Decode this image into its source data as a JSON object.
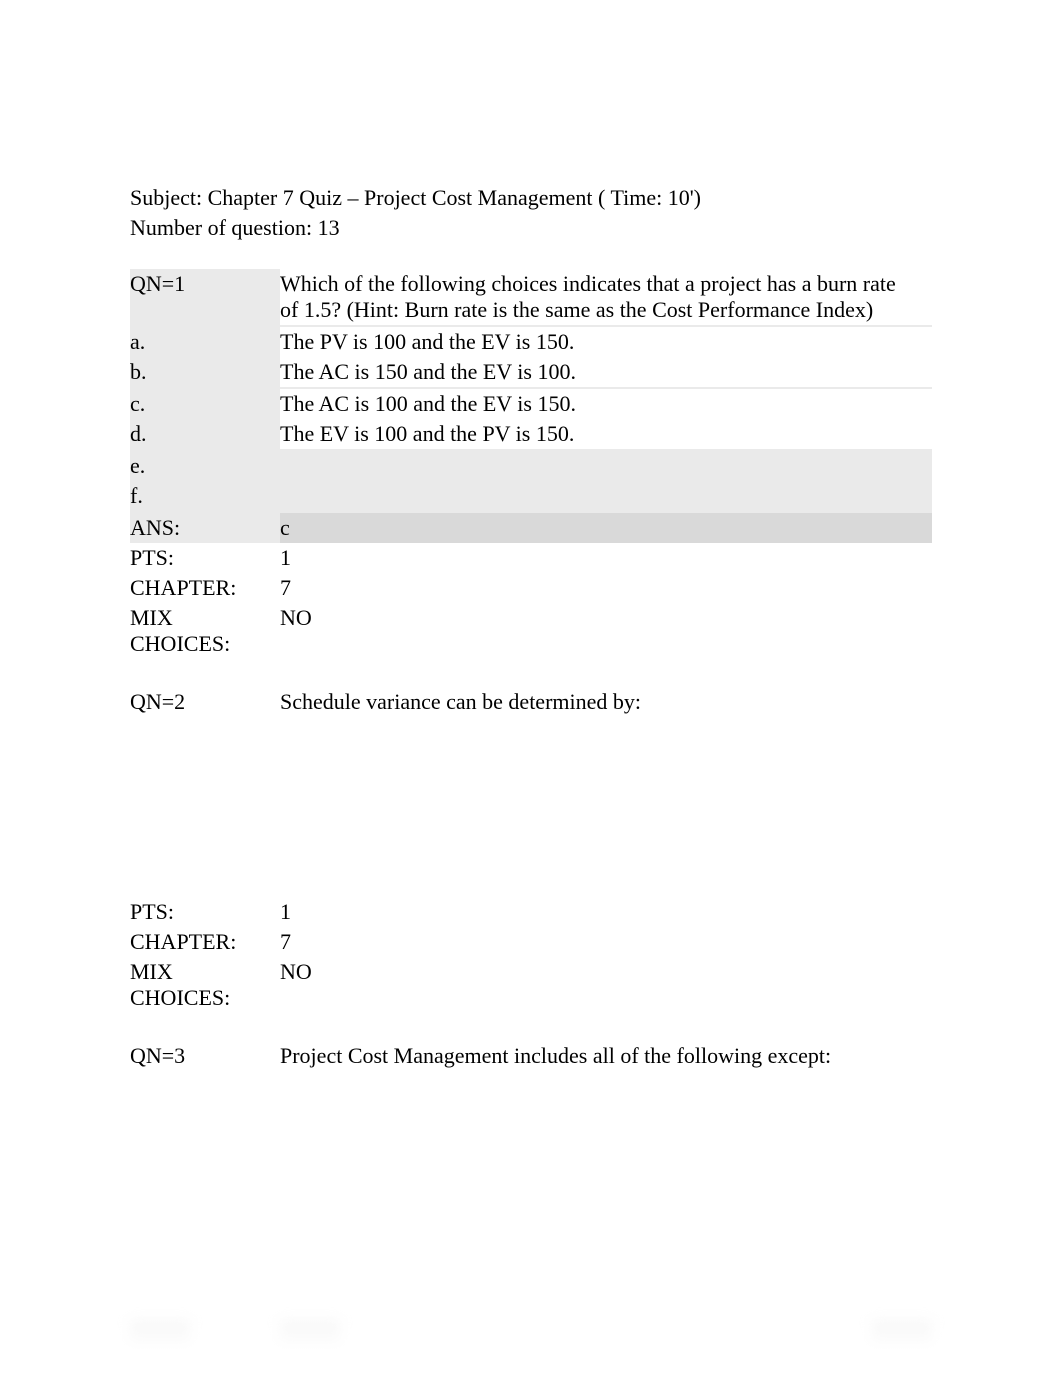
{
  "header": {
    "subject_line": "Subject: Chapter 7 Quiz – Project Cost Management ( Time: 10')",
    "num_q_line": "Number of question: 13"
  },
  "q1": {
    "qn_label": "QN=1",
    "question_l1": "Which of the following choices indicates that a project has a burn rate",
    "question_l2": "of 1.5? (Hint: Burn rate is the same as the Cost Performance Index)",
    "a_label": "a.",
    "a_text": "The PV is 100 and the EV is 150.",
    "b_label": "b.",
    "b_text": "The AC is 150 and the EV is 100.",
    "c_label": "c.",
    "c_text": "The AC is 100 and the EV is 150.",
    "d_label": "d.",
    "d_text": "The EV is 100 and the PV is 150.",
    "e_label": "e.",
    "e_text": "",
    "f_label": "f.",
    "f_text": "",
    "ans_label": "ANS:",
    "ans_text": "c",
    "pts_label": "PTS:",
    "pts_text": "1",
    "chapter_label": "CHAPTER:",
    "chapter_text": "7",
    "mix_label_l1": "MIX",
    "mix_label_l2": "CHOICES:",
    "mix_text": "NO"
  },
  "q2": {
    "qn_label": "QN=2",
    "question": "Schedule variance can be determined by:",
    "pts_label": "PTS:",
    "pts_text": "1",
    "chapter_label": "CHAPTER:",
    "chapter_text": "7",
    "mix_label_l1": "MIX",
    "mix_label_l2": "CHOICES:",
    "mix_text": "NO"
  },
  "q3": {
    "qn_label": "QN=3",
    "question": "Project Cost Management includes all of the following except:"
  }
}
